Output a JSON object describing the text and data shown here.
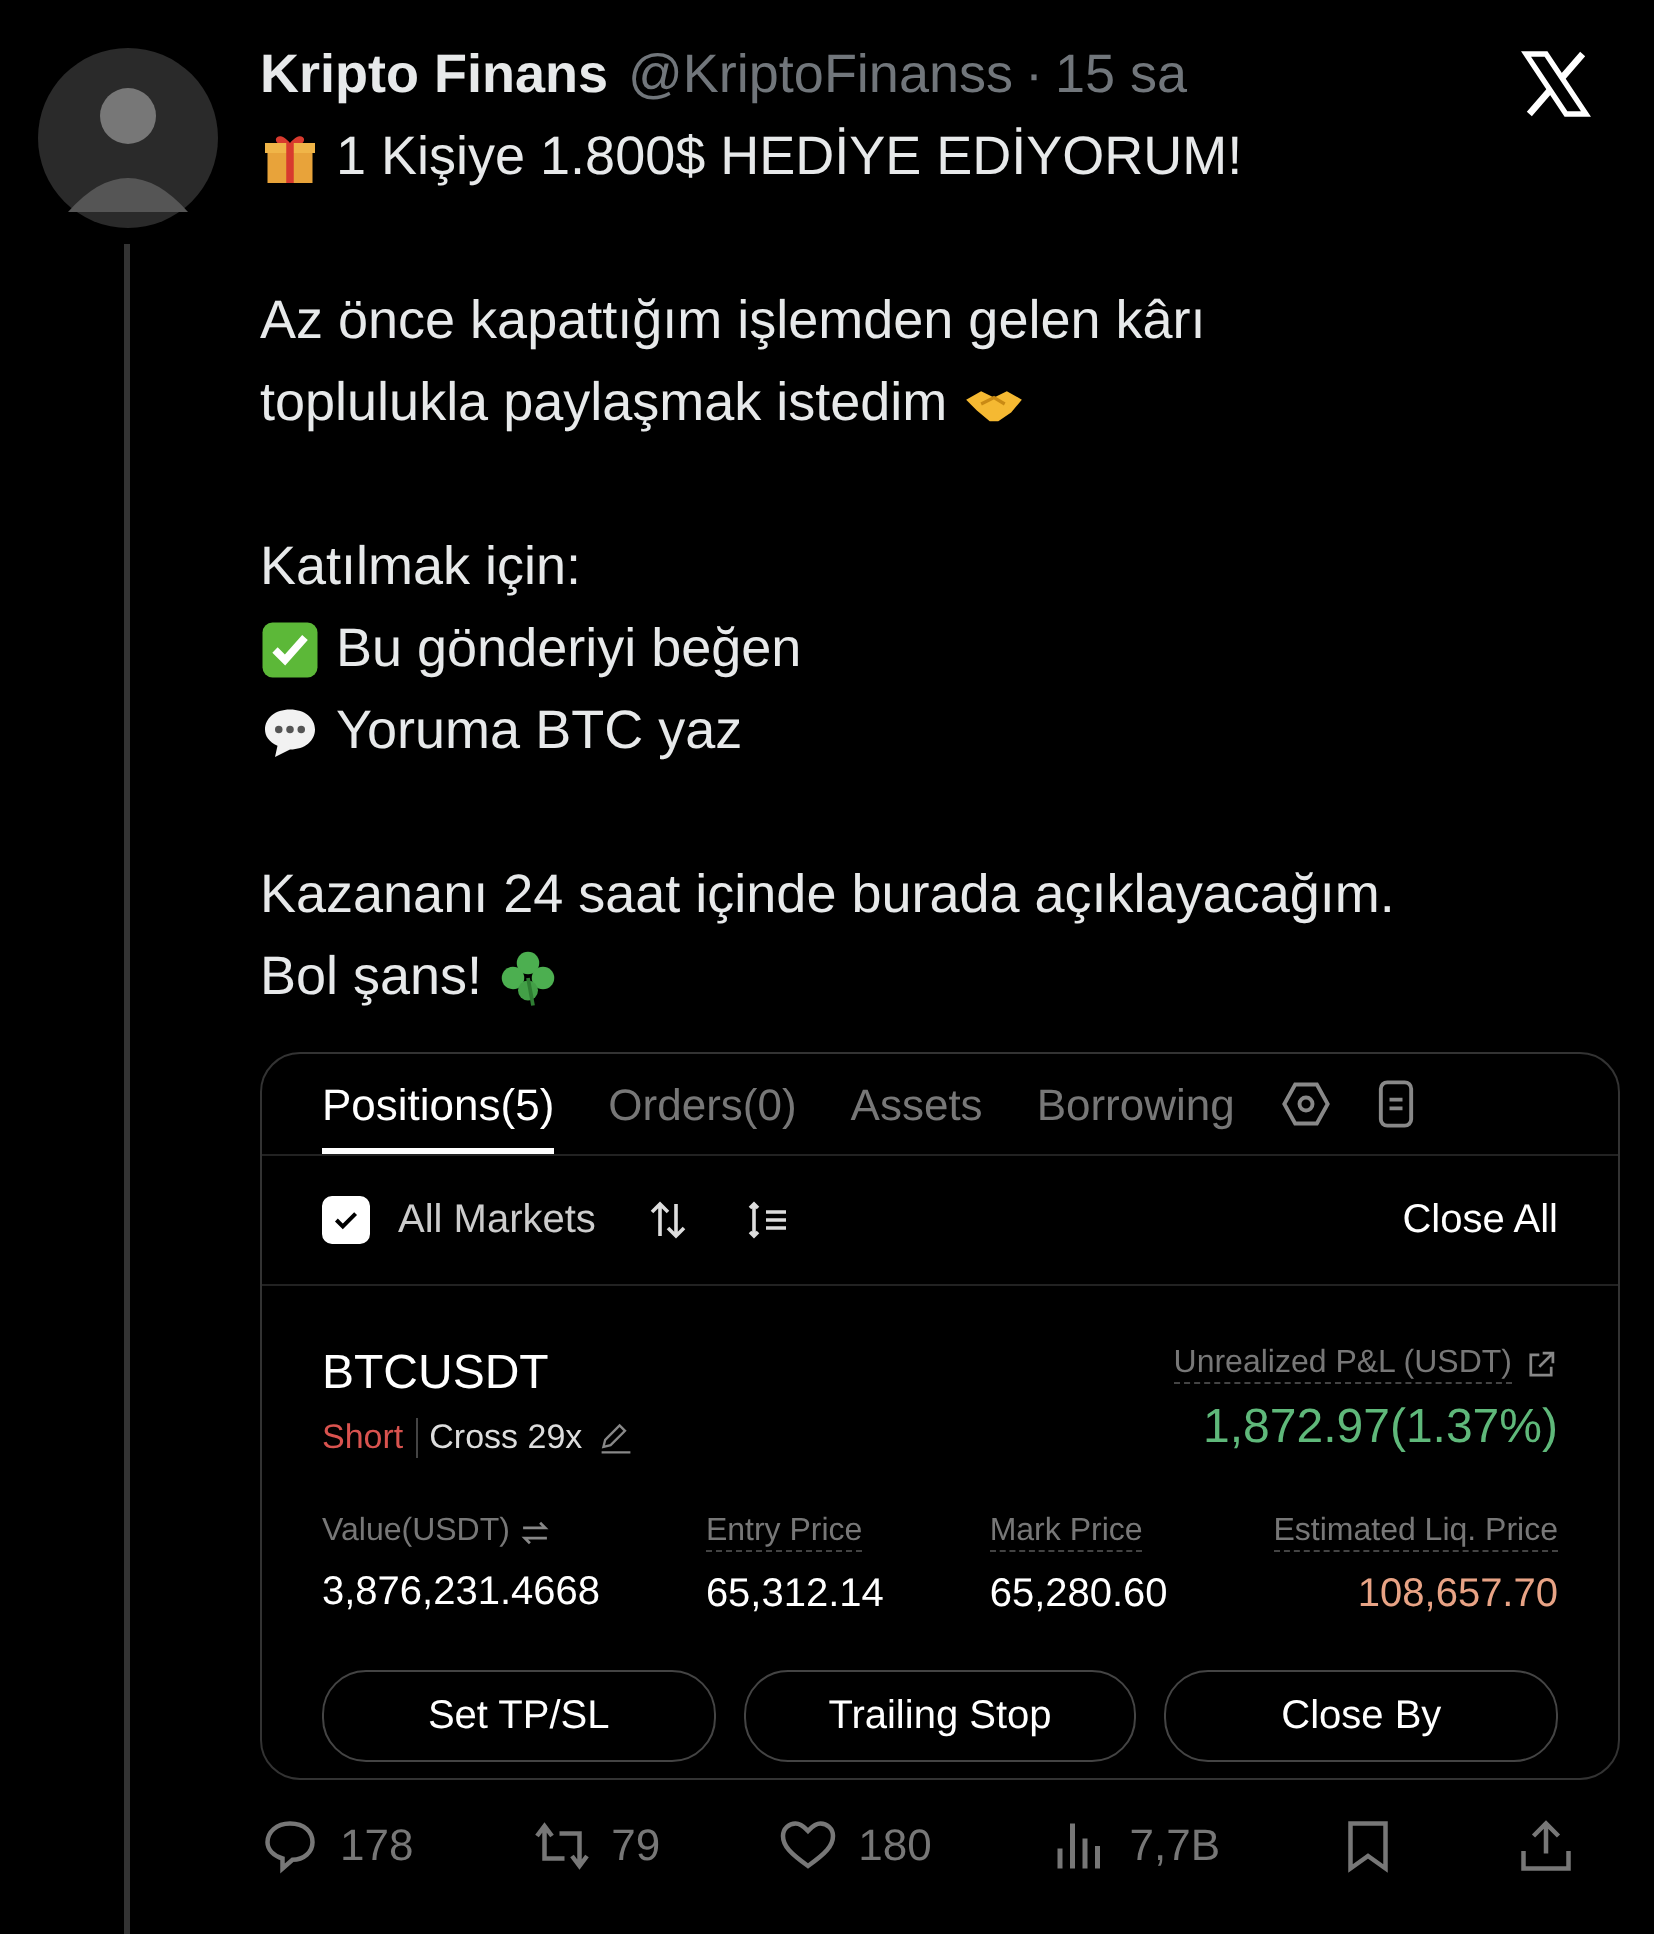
{
  "author": {
    "name": "Kripto Finans",
    "handle": "@KriptoFinanss",
    "separator": "·",
    "time": "15 sa"
  },
  "paragraphs": [
    {
      "lines": [
        {
          "text": "1 Kişiye 1.800$ HEDİYE EDİYORUM!",
          "icon_before": true
        }
      ]
    },
    {
      "lines": [
        {
          "text": "Az önce kapattığım işlemden gelen kârı"
        },
        {
          "text": "toplulukla paylaşmak istedim",
          "icon_after": true
        }
      ]
    },
    {
      "lines": [
        {
          "text": "Katılmak için:"
        },
        {
          "text": "Bu gönderiyi beğen",
          "icon_before": true
        },
        {
          "text": "Yoruma BTC yaz",
          "icon_before": true
        }
      ]
    },
    {
      "lines": [
        {
          "text": "Kazananı 24 saat içinde burada açıklayacağım."
        },
        {
          "text": "Bol şans!",
          "icon_after": true
        }
      ]
    }
  ],
  "card": {
    "tabs": [
      {
        "label": "Positions(5)",
        "selected": true
      },
      {
        "label": "Orders(0)",
        "selected": false
      },
      {
        "label": "Assets",
        "selected": false
      },
      {
        "label": "Borrowing",
        "selected": false
      }
    ],
    "filter": {
      "label": "All Markets",
      "checked": true
    },
    "close_all": "Close All",
    "position": {
      "symbol": "BTCUSDT",
      "side": "Short",
      "mode": "Cross 29x",
      "pnl_label": "Unrealized P&L (USDT)",
      "pnl_value": "1,872.97(1.37%)",
      "metrics": [
        {
          "label": "Value(USDT)",
          "value": "3,876,231.4668",
          "color": "#ffffff",
          "swap": true
        },
        {
          "label": "Entry Price",
          "value": "65,312.14",
          "color": "#ffffff",
          "swap": false
        },
        {
          "label": "Mark Price",
          "value": "65,280.60",
          "color": "#ffffff",
          "swap": false
        },
        {
          "label": "Estimated Liq. Price",
          "value": "108,657.70",
          "color": "#e8a385",
          "swap": false
        }
      ]
    },
    "buttons": [
      "Set TP/SL",
      "Trailing Stop",
      "Close By"
    ]
  },
  "actions": [
    {
      "kind": "reply",
      "count": "178"
    },
    {
      "kind": "repost",
      "count": "79"
    },
    {
      "kind": "like",
      "count": "180"
    },
    {
      "kind": "views",
      "count": "7,7B"
    },
    {
      "kind": "bookmark"
    },
    {
      "kind": "share"
    }
  ]
}
